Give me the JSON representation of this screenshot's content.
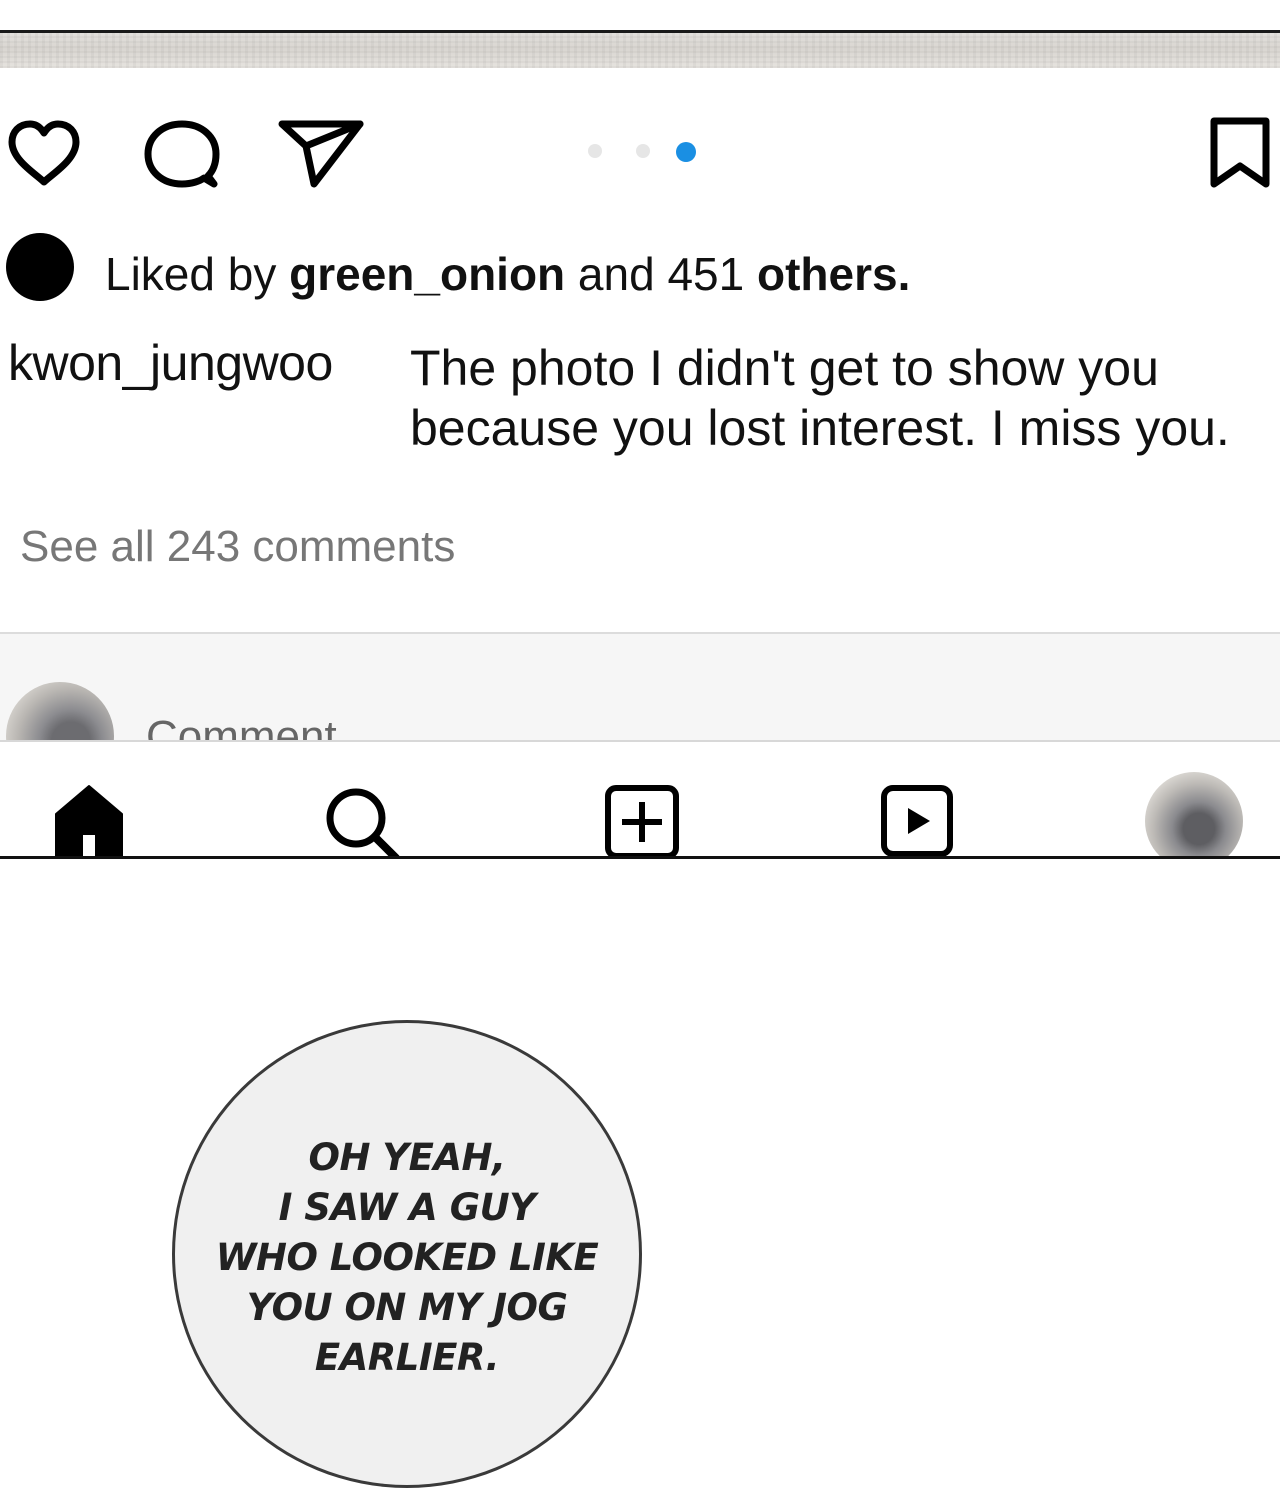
{
  "post": {
    "carousel": {
      "count": 3,
      "active_index": 2,
      "active_color": "#1a8fe3",
      "inactive_color": "#e6e6e6"
    },
    "actions": {
      "like_icon": "heart-icon",
      "comment_icon": "comment-bubble-icon",
      "share_icon": "paper-plane-icon",
      "save_icon": "bookmark-icon"
    },
    "likes": {
      "prefix": "Liked by ",
      "user": "green_onion",
      "middle": " and 451 ",
      "others": "others."
    },
    "caption": {
      "username": "kwon_jungwoo",
      "text": "The photo I didn't get to show you because you lost interest. I miss you."
    },
    "see_all_comments": "See all 243 comments",
    "comment_input": {
      "placeholder": "Comment"
    }
  },
  "bottom_nav": {
    "items": [
      "home-icon",
      "search-icon",
      "add-post-icon",
      "reels-icon",
      "profile-avatar"
    ]
  },
  "speech_bubble": {
    "lines": [
      "OH YEAH,",
      "I SAW A GUY",
      "WHO LOOKED LIKE",
      "YOU ON MY JOG",
      "EARLIER."
    ]
  }
}
